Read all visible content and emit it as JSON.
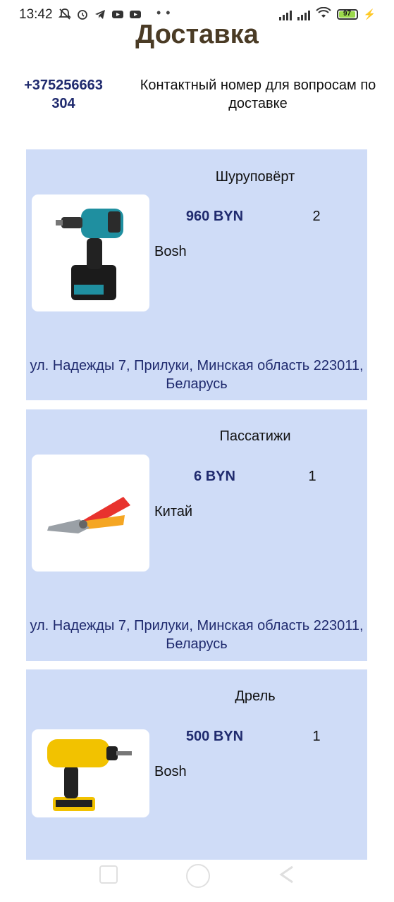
{
  "status_bar": {
    "time": "13:42",
    "battery": "97",
    "battery_level": 0.97
  },
  "header": {
    "title": "Доставка",
    "phone": "+375256663304",
    "phone_caption": "Контактный номер для вопросам по доставке"
  },
  "orders": [
    {
      "name": "Шуруповёрт",
      "price": "960 BYN",
      "quantity": "2",
      "brand": "Bosh",
      "address": "ул. Надежды 7, Прилуки, Минская область 223011, Беларусь",
      "image_icon": "cordless-drill-teal-icon"
    },
    {
      "name": "Пассатижи",
      "price": "6 BYN",
      "quantity": "1",
      "brand": "Китай",
      "address": "ул. Надежды 7, Прилуки, Минская область 223011, Беларусь",
      "image_icon": "pliers-red-icon"
    },
    {
      "name": "Дрель",
      "price": "500 BYN",
      "quantity": "1",
      "brand": "Bosh",
      "address": "",
      "image_icon": "drill-yellow-icon"
    }
  ],
  "colors": {
    "title": "#4a3b25",
    "accent": "#1f2a6e",
    "card_background": "#cfdcf7"
  }
}
